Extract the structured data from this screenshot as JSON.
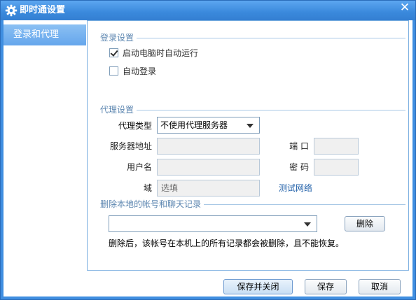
{
  "window": {
    "title": "即时通设置",
    "close_glyph": "✕"
  },
  "sidebar": {
    "items": [
      {
        "label": "登录和代理",
        "selected": true
      }
    ]
  },
  "login_section": {
    "title": "登录设置",
    "auto_start": {
      "label": "启动电脑时自动运行",
      "checked": true
    },
    "auto_login": {
      "label": "自动登录",
      "checked": false
    }
  },
  "proxy_section": {
    "title": "代理设置",
    "proxy_type_label": "代理类型",
    "proxy_type_value": "不使用代理服务器",
    "server_label": "服务器地址",
    "port_label": "端 口",
    "username_label": "用户名",
    "password_label": "密 码",
    "domain_label": "域",
    "domain_placeholder": "选填",
    "test_link": "测试网络"
  },
  "delete_section": {
    "title": "删除本地的帐号和聊天记录",
    "account_value": "",
    "delete_button": "删除",
    "note": "删除后，该帐号在本机上的所有记录都会被删除，且不能恢复。"
  },
  "footer": {
    "save_close": "保存并关闭",
    "save": "保存",
    "cancel": "取消"
  },
  "colors": {
    "title_bar": "#3a89dc",
    "sidebar_selected": "#6aa9ed",
    "link": "#1f5fa8",
    "section_title": "#5c86b0"
  }
}
